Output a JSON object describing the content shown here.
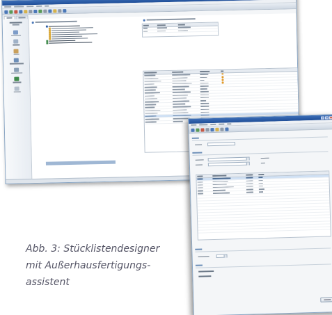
{
  "caption": {
    "line1": "Abb. 3: Stücklistendesigner",
    "line2": "mit Außerhausfertigungs-",
    "line3": "assistent"
  },
  "colors": {
    "titlebar": "#2b5ba8",
    "selection": "#cfe0f4",
    "status_orange": "#e39b2a",
    "caption_text": "#556677"
  },
  "icons": [
    "window-close-icon",
    "window-maximize-icon",
    "window-minimize-icon",
    "toolbar-icons",
    "tree-node-icon",
    "status-dot-icon",
    "dropdown-arrow-icon"
  ]
}
